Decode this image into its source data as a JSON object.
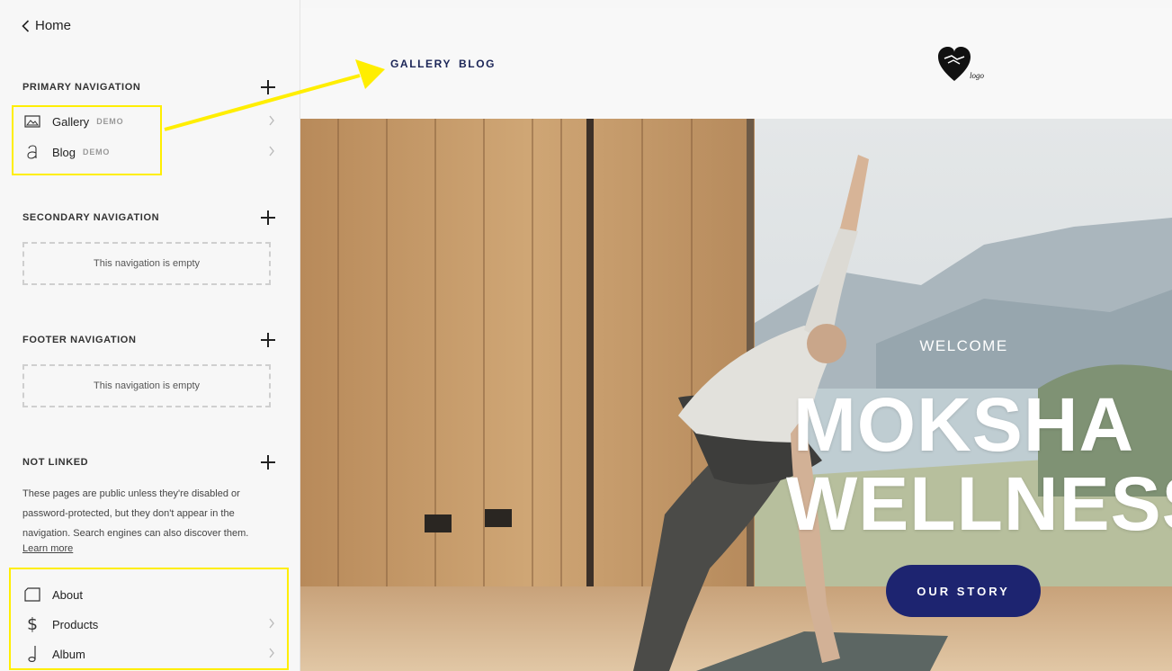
{
  "sidebar": {
    "back_label": "Home",
    "primary": {
      "title": "PRIMARY NAVIGATION",
      "items": [
        {
          "label": "Gallery",
          "badge": "DEMO",
          "icon": "image-icon"
        },
        {
          "label": "Blog",
          "badge": "DEMO",
          "icon": "blog-icon"
        }
      ]
    },
    "secondary": {
      "title": "SECONDARY NAVIGATION",
      "empty_text": "This navigation is empty"
    },
    "footer": {
      "title": "FOOTER NAVIGATION",
      "empty_text": "This navigation is empty"
    },
    "not_linked": {
      "title": "NOT LINKED",
      "note": "These pages are public unless they're disabled or password-protected, but they don't appear in the navigation. Search engines can also discover them.",
      "learn_more": "Learn more",
      "items": [
        {
          "label": "About",
          "icon": "page-icon"
        },
        {
          "label": "Products",
          "icon": "dollar-icon"
        },
        {
          "label": "Album",
          "icon": "music-note-icon"
        }
      ]
    }
  },
  "preview": {
    "nav": [
      "GALLERY",
      "BLOG"
    ],
    "logo_text": "logo",
    "welcome": "WELCOME",
    "headline_line1": "MOKSHA",
    "headline_line2": "WELLNESS",
    "cta": "OUR STORY"
  },
  "colors": {
    "highlight": "#ffee00",
    "brand_navy": "#1d2470",
    "nav_text": "#1b2557"
  }
}
